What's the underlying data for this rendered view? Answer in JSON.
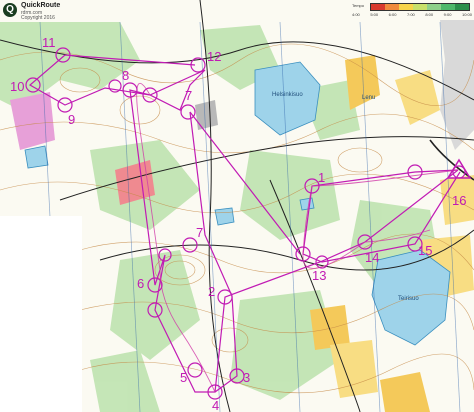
{
  "app": {
    "brand": "QuickRoute",
    "subtitle_line1": "rdrm.com",
    "subtitle_line2": "Copyright 2016"
  },
  "speed_scale": {
    "title": "Tempo",
    "colors": [
      "#d83a2e",
      "#f08a3c",
      "#f7d44a",
      "#c8e06a",
      "#8ed08a",
      "#4fb86a",
      "#2c8f4a"
    ],
    "labels": [
      "4:00",
      "5:00",
      "6:00",
      "7:00",
      "8:00",
      "9:00",
      "10:00"
    ]
  },
  "map": {
    "lake_labels": [
      "Helsinkisuo",
      "Lenu",
      "Teirisuo"
    ],
    "course_color": "#c11bb4",
    "route_color": "#d13aa8",
    "controls": [
      {
        "number": "1"
      },
      {
        "number": "2"
      },
      {
        "number": "3"
      },
      {
        "number": "4"
      },
      {
        "number": "5"
      },
      {
        "number": "6"
      },
      {
        "number": "7"
      },
      {
        "number": "7"
      },
      {
        "number": "8"
      },
      {
        "number": "9"
      },
      {
        "number": "10"
      },
      {
        "number": "11"
      },
      {
        "number": "12"
      },
      {
        "number": "13"
      },
      {
        "number": "14"
      },
      {
        "number": "15"
      },
      {
        "number": "16"
      }
    ]
  }
}
